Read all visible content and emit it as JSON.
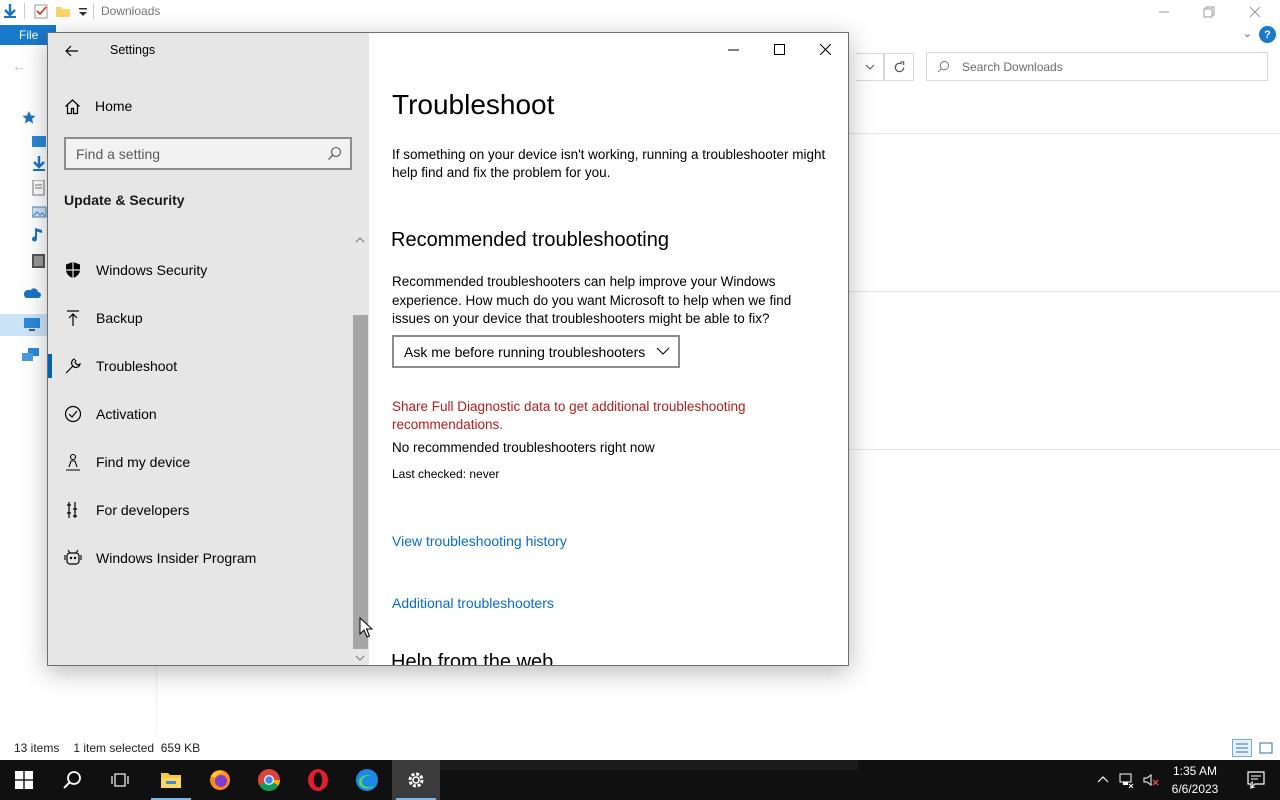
{
  "explorer": {
    "title": "Downloads",
    "file_tab": "File",
    "help": "?",
    "search_placeholder": "Search Downloads",
    "status_items": "13 items",
    "status_selected": "1 item selected  659 KB"
  },
  "settings": {
    "window_title": "Settings",
    "home_label": "Home",
    "search_placeholder": "Find a setting",
    "section_heading": "Update & Security",
    "nav_items": [
      {
        "label": "Windows Security",
        "icon": "shield-icon"
      },
      {
        "label": "Backup",
        "icon": "backup-icon"
      },
      {
        "label": "Troubleshoot",
        "icon": "wrench-icon",
        "selected": true
      },
      {
        "label": "Activation",
        "icon": "check-circle-icon"
      },
      {
        "label": "Find my device",
        "icon": "person-location-icon"
      },
      {
        "label": "For developers",
        "icon": "developer-icon"
      },
      {
        "label": "Windows Insider Program",
        "icon": "insider-icon"
      }
    ],
    "page": {
      "title": "Troubleshoot",
      "intro": "If something on your device isn't working, running a troubleshooter might help find and fix the problem for you.",
      "rec_heading": "Recommended troubleshooting",
      "rec_desc": "Recommended troubleshooters can help improve your Windows experience. How much do you want Microsoft to help when we find issues on your device that troubleshooters might be able to fix?",
      "rec_dropdown_value": "Ask me before running troubleshooters",
      "diag_link": "Share Full Diagnostic data to get additional troubleshooting recommendations.",
      "no_rec": "No recommended troubleshooters right now",
      "last_checked": "Last checked: never",
      "history_link": "View troubleshooting history",
      "additional_link": "Additional troubleshooters",
      "help_heading": "Help from the web"
    }
  },
  "taskbar": {
    "apps": [
      "start-icon",
      "search-icon",
      "task-view-icon",
      "file-explorer-icon",
      "firefox-icon",
      "chrome-icon",
      "opera-icon",
      "edge-icon",
      "settings-icon"
    ],
    "time": "1:35 AM",
    "date": "6/6/2023",
    "notification_count": "1"
  },
  "colors": {
    "accent": "#0063b1",
    "link": "#0a6cc4",
    "warning_link": "#b01e1e",
    "sidebar_bg": "#e6e6e6",
    "taskbar_bg": "#101010"
  }
}
